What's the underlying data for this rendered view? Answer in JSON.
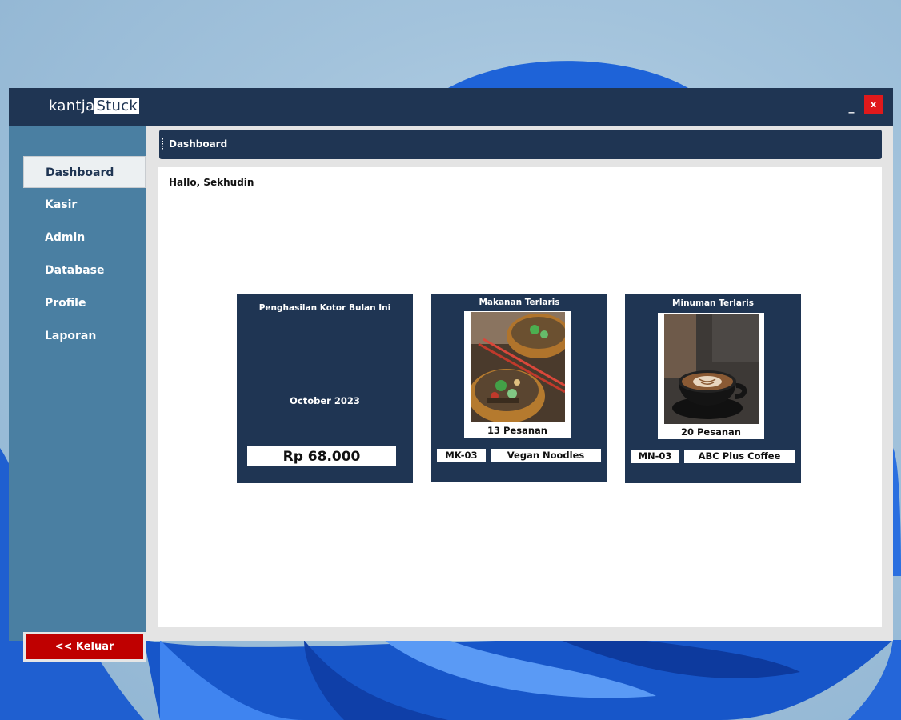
{
  "app": {
    "logo_left": "kantja",
    "logo_right": "Stuck",
    "minimize_label": "_",
    "close_label": "x"
  },
  "sidebar": {
    "items": [
      {
        "label": "Dashboard",
        "active": true
      },
      {
        "label": "Kasir"
      },
      {
        "label": "Admin"
      },
      {
        "label": "Database"
      },
      {
        "label": "Profile"
      },
      {
        "label": "Laporan"
      }
    ],
    "logout_label": "<< Keluar"
  },
  "header": {
    "title": "Dashboard"
  },
  "main": {
    "greeting": "Hallo, Sekhudin",
    "income_card": {
      "title": "Penghasilan Kotor Bulan Ini",
      "period": "October 2023",
      "amount": "Rp 68.000"
    },
    "food_card": {
      "title": "Makanan Terlaris",
      "orders": "13 Pesanan",
      "code": "MK-03",
      "name": "Vegan Noodles",
      "image_icon": "noodle-bowl-photo"
    },
    "drink_card": {
      "title": "Minuman Terlaris",
      "orders": "20 Pesanan",
      "code": "MN-03",
      "name": "ABC Plus Coffee",
      "image_icon": "coffee-cup-photo"
    }
  },
  "colors": {
    "navy": "#1f3553",
    "sidebar_blue": "#4a7fa2",
    "logout_red": "#bf0000",
    "close_red": "#e0191b"
  }
}
